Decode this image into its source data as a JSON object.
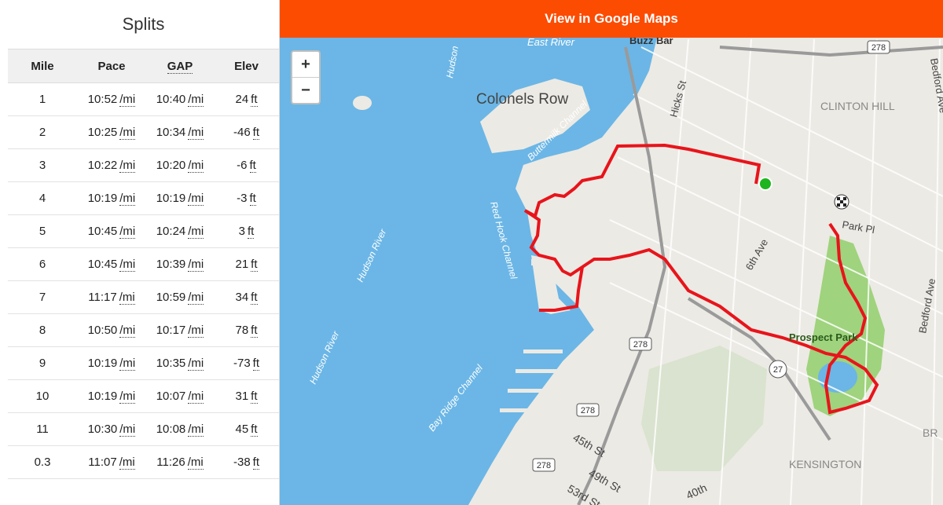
{
  "splits": {
    "title": "Splits",
    "headers": {
      "mile": "Mile",
      "pace": "Pace",
      "gap": "GAP",
      "elev": "Elev"
    },
    "rows": [
      {
        "mile": "1",
        "pace": "10:52",
        "pace_unit": "/mi",
        "gap": "10:40",
        "gap_unit": "/mi",
        "elev": "24",
        "elev_unit": "ft"
      },
      {
        "mile": "2",
        "pace": "10:25",
        "pace_unit": "/mi",
        "gap": "10:34",
        "gap_unit": "/mi",
        "elev": "-46",
        "elev_unit": "ft"
      },
      {
        "mile": "3",
        "pace": "10:22",
        "pace_unit": "/mi",
        "gap": "10:20",
        "gap_unit": "/mi",
        "elev": "-6",
        "elev_unit": "ft"
      },
      {
        "mile": "4",
        "pace": "10:19",
        "pace_unit": "/mi",
        "gap": "10:19",
        "gap_unit": "/mi",
        "elev": "-3",
        "elev_unit": "ft"
      },
      {
        "mile": "5",
        "pace": "10:45",
        "pace_unit": "/mi",
        "gap": "10:24",
        "gap_unit": "/mi",
        "elev": "3",
        "elev_unit": "ft"
      },
      {
        "mile": "6",
        "pace": "10:45",
        "pace_unit": "/mi",
        "gap": "10:39",
        "gap_unit": "/mi",
        "elev": "21",
        "elev_unit": "ft"
      },
      {
        "mile": "7",
        "pace": "11:17",
        "pace_unit": "/mi",
        "gap": "10:59",
        "gap_unit": "/mi",
        "elev": "34",
        "elev_unit": "ft"
      },
      {
        "mile": "8",
        "pace": "10:50",
        "pace_unit": "/mi",
        "gap": "10:17",
        "gap_unit": "/mi",
        "elev": "78",
        "elev_unit": "ft"
      },
      {
        "mile": "9",
        "pace": "10:19",
        "pace_unit": "/mi",
        "gap": "10:35",
        "gap_unit": "/mi",
        "elev": "-73",
        "elev_unit": "ft"
      },
      {
        "mile": "10",
        "pace": "10:19",
        "pace_unit": "/mi",
        "gap": "10:07",
        "gap_unit": "/mi",
        "elev": "31",
        "elev_unit": "ft"
      },
      {
        "mile": "11",
        "pace": "10:30",
        "pace_unit": "/mi",
        "gap": "10:08",
        "gap_unit": "/mi",
        "elev": "45",
        "elev_unit": "ft"
      },
      {
        "mile": "0.3",
        "pace": "11:07",
        "pace_unit": "/mi",
        "gap": "11:26",
        "gap_unit": "/mi",
        "elev": "-38",
        "elev_unit": "ft"
      }
    ]
  },
  "map": {
    "google_maps_button": "View in Google Maps",
    "zoom_in": "+",
    "zoom_out": "−",
    "labels": {
      "east_river": "East River",
      "buzz_bar": "Buzz Bar",
      "hicks_st": "Hicks St",
      "colonels_row": "Colonels Row",
      "buttermilk_channel": "Buttermilk Channel",
      "hudson_top": "Hudson",
      "red_hook_channel": "Red Hook Channel",
      "hudson_river_1": "Hudson River",
      "hudson_river_2": "Hudson River",
      "bay_ridge_channel": "Bay Ridge Channel",
      "clinton_hill": "CLINTON HILL",
      "bedford_ave_1": "Bedford Ave",
      "bedford_ave_2": "Bedford Ave",
      "park_pl": "Park Pl",
      "sixth_ave": "6th Ave",
      "prospect_park": "Prospect Park",
      "kensington": "KENSINGTON",
      "br": "BR",
      "forty_fifth_st": "45th St",
      "forty_ninth_st": "49th St",
      "fifty_third_st": "53rd St",
      "fortieth": "40th",
      "highway_278": "278",
      "highway_27": "27"
    },
    "colors": {
      "water": "#6bb6e6",
      "land": "#eceae4",
      "park": "#9fd37d",
      "route": "#e8141b",
      "start": "#1eb51e",
      "accent": "#fc4c02"
    },
    "icons": [
      "start-marker-icon",
      "finish-flag-icon"
    ]
  }
}
